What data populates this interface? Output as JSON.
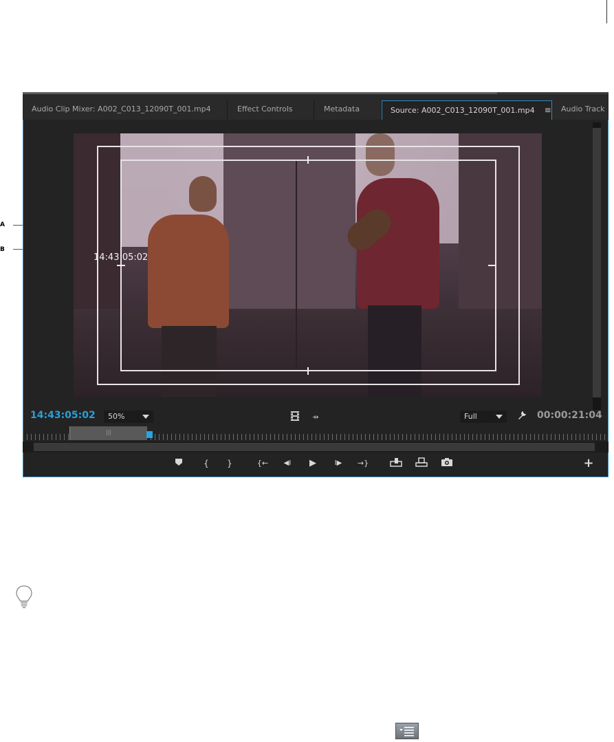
{
  "tabs": [
    {
      "label": "Audio Clip Mixer: A002_C013_12090T_001.mp4",
      "active": false
    },
    {
      "label": "Effect Controls",
      "active": false
    },
    {
      "label": "Metadata",
      "active": false
    },
    {
      "label": "Source: A002_C013_12090T_001.mp4",
      "active": true
    },
    {
      "label": "Audio Track",
      "active": false
    }
  ],
  "tab_menu_icon": "≡",
  "monitor": {
    "overlay_timecode": "14:43:05:02",
    "current_timecode": "14:43:05:02",
    "duration_timecode": "00:00:21:04",
    "zoom": "50%",
    "quality": "Full"
  },
  "callouts": {
    "a": "A",
    "b": "B"
  },
  "transport_buttons": [
    {
      "name": "add-marker",
      "glyph": "⯆"
    },
    {
      "name": "mark-in",
      "glyph": "{"
    },
    {
      "name": "mark-out",
      "glyph": "}"
    },
    {
      "name": "go-to-in",
      "glyph": "{←"
    },
    {
      "name": "step-back",
      "glyph": "◀I"
    },
    {
      "name": "play",
      "glyph": "▶"
    },
    {
      "name": "step-forward",
      "glyph": "I▶"
    },
    {
      "name": "go-to-out",
      "glyph": "→}"
    },
    {
      "name": "insert",
      "glyph": "⬒"
    },
    {
      "name": "overwrite",
      "glyph": "⬓"
    },
    {
      "name": "export-frame",
      "glyph": "◙"
    }
  ],
  "colors": {
    "accent_blue": "#2a9fd8",
    "panel_border": "#2a8cc7",
    "panel_bg": "#232323"
  },
  "icons": [
    "film-icon",
    "drag-audio-icon",
    "wrench-icon",
    "add-button-icon",
    "lightbulb-icon",
    "panel-menu-icon"
  ]
}
